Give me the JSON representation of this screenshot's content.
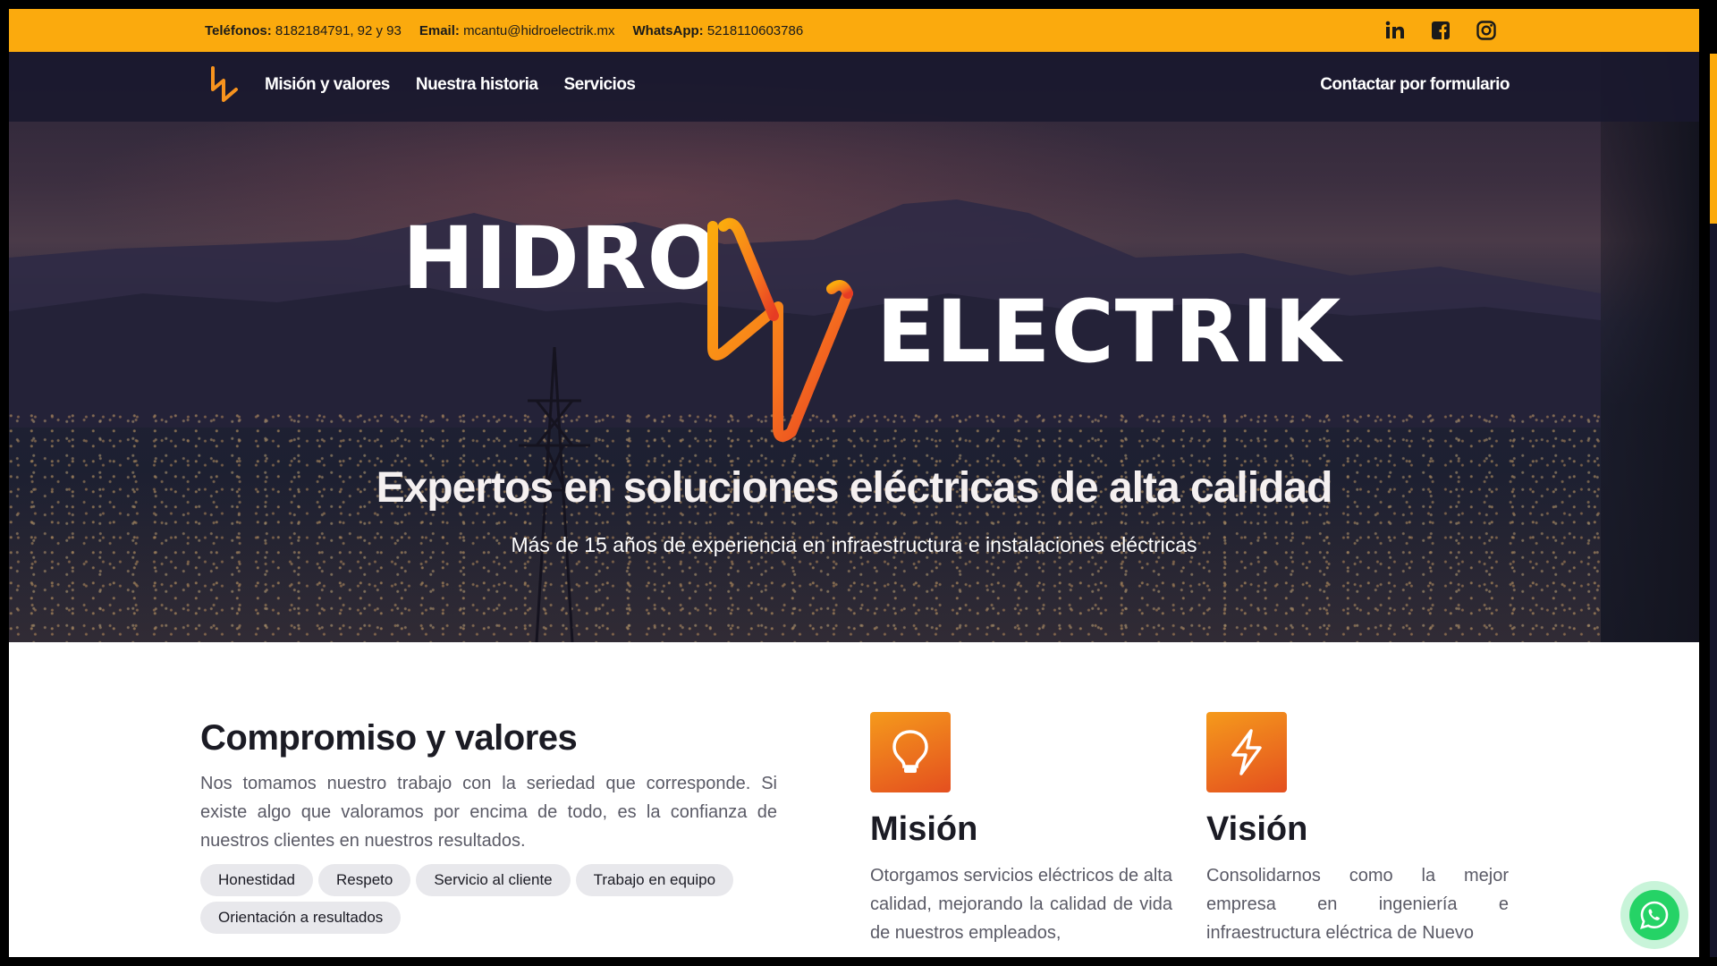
{
  "topbar": {
    "phones_label": "Teléfonos:",
    "phones_value": "8182184791, 92 y 93",
    "email_label": "Email:",
    "email_value": "mcantu@hidroelectrik.mx",
    "whatsapp_label": "WhatsApp:",
    "whatsapp_value": "5218110603786",
    "social": [
      "linkedin-icon",
      "facebook-icon",
      "instagram-icon"
    ]
  },
  "nav": {
    "links": [
      "Misión y valores",
      "Nuestra historia",
      "Servicios"
    ],
    "contact": "Contactar por formulario"
  },
  "hero": {
    "brand_top": "HIDRO",
    "brand_bottom": "ELECTRIK",
    "title": "Expertos en soluciones eléctricas de alta calidad",
    "subtitle": "Más de 15 años de experiencia en infraestructura e instalaciones eléctricas"
  },
  "values": {
    "title": "Compromiso y valores",
    "text": "Nos tomamos nuestro trabajo con la seriedad que corresponde. Si existe algo que valoramos por encima de todo, es la confianza de nuestros clientes en nuestros resultados.",
    "tags": [
      "Honestidad",
      "Respeto",
      "Servicio al cliente",
      "Trabajo en equipo",
      "Orientación a resultados"
    ]
  },
  "mision": {
    "icon": "lightbulb-icon",
    "title": "Misión",
    "text": "Otorgamos servicios eléctricos de alta calidad, mejorando la calidad de vida de nuestros empleados,"
  },
  "vision": {
    "icon": "lightning-icon",
    "title": "Visión",
    "text": "Consolidarnos como la mejor empresa en ingeniería e infraestructura eléctrica de Nuevo"
  },
  "colors": {
    "accent": "#fbaa0d",
    "orange_gradient_start": "#f59a1c",
    "orange_gradient_end": "#e44f1f",
    "whatsapp": "#25d366"
  }
}
